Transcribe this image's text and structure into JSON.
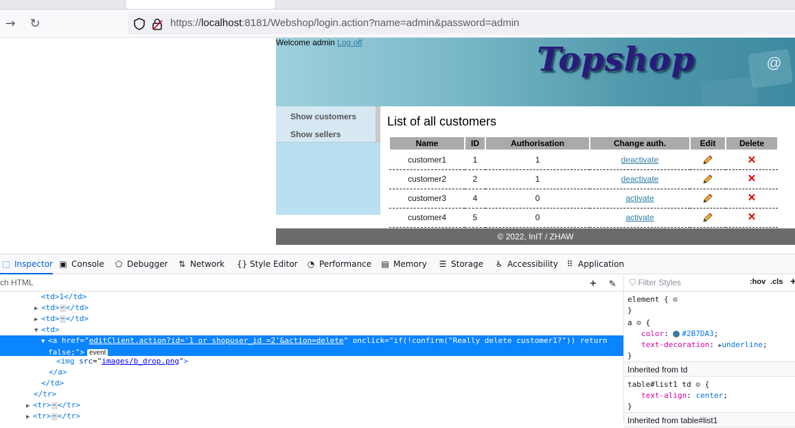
{
  "browser": {
    "url_prefix": "https://",
    "url_host": "localhost",
    "url_rest": ":8181/Webshop/login.action?name=admin&password=admin"
  },
  "site": {
    "welcome_text": "Welcome admin",
    "logout_label": "Log off",
    "logo_text": "Topshop",
    "sidebar": [
      "Show customers",
      "Show sellers"
    ],
    "title": "List of all customers",
    "columns": [
      "Name",
      "ID",
      "Authorisation",
      "Change auth.",
      "Edit",
      "Delete"
    ],
    "rows": [
      {
        "name": "customer1",
        "id": "1",
        "auth": "1",
        "change": "deactivate"
      },
      {
        "name": "customer2",
        "id": "2",
        "auth": "1",
        "change": "deactivate"
      },
      {
        "name": "customer3",
        "id": "4",
        "auth": "0",
        "change": "activate"
      },
      {
        "name": "customer4",
        "id": "5",
        "auth": "0",
        "change": "activate"
      }
    ],
    "footer": "© 2022, InIT / ZHAW"
  },
  "devtools": {
    "tabs": [
      "Inspector",
      "Console",
      "Debugger",
      "Network",
      "Style Editor",
      "Performance",
      "Memory",
      "Storage",
      "Accessibility",
      "Application"
    ],
    "active_tab": "Inspector",
    "search_placeholder": "ch HTML",
    "markup": {
      "line_td1": "<td>1</td>",
      "selected_href": "editClient.action?id='1 or shopuser_id =2'&action=delete",
      "selected_onclick": "if(!confirm(\"Really delete customer1?\")) return",
      "selected_cont": "false;",
      "event_badge": "event",
      "img_src": "images/b_drop.png"
    },
    "rules": {
      "filter_placeholder": "Filter Styles",
      "hov": ":hov",
      "cls": ".cls",
      "element_selector": "element",
      "a_selector": "a",
      "color_prop": "color",
      "color_value": "#2B7DA3",
      "decoration_prop": "text-decoration",
      "decoration_value": "underline",
      "inherited_td": "Inherited from td",
      "td_selector": "table#list1 td",
      "align_prop": "text-align",
      "align_value": "center",
      "inherited_table": "Inherited from table#list1"
    }
  }
}
